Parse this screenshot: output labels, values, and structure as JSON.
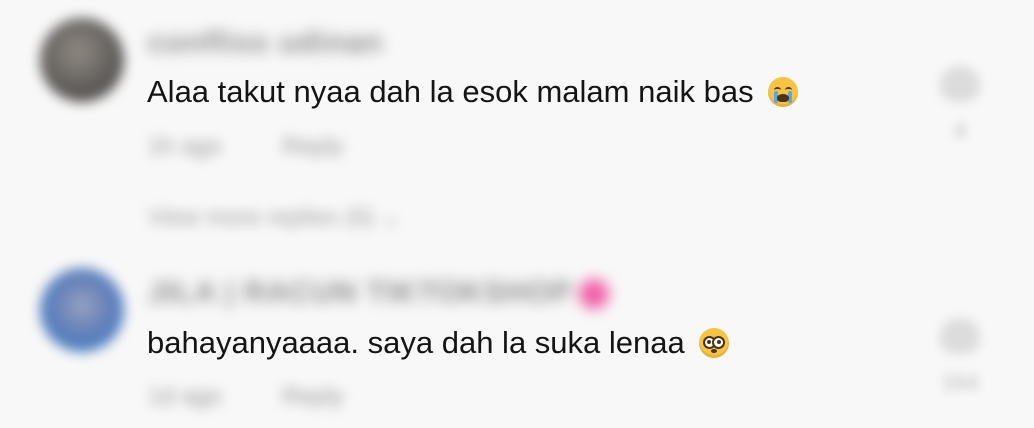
{
  "comments": [
    {
      "username": "confliss udinan",
      "text": "Alaa takut nyaa dah la esok malam naik bas",
      "emoji": "loudly-crying-face",
      "time": "1h ago",
      "reply_label": "Reply",
      "view_more": "View more replies (6) ⌄",
      "like_count": "4"
    },
    {
      "username": "JILA | RACUN TIKTOKSHOP",
      "text": "bahayanyaaaa. saya dah la suka lenaa",
      "emoji": "flushed-face",
      "time": "1d ago",
      "reply_label": "Reply",
      "like_count": "164"
    }
  ],
  "colors": {
    "background": "#f8f8f8",
    "text": "#141414",
    "muted": "#9a9a9a",
    "flair": "#f05fa8"
  }
}
